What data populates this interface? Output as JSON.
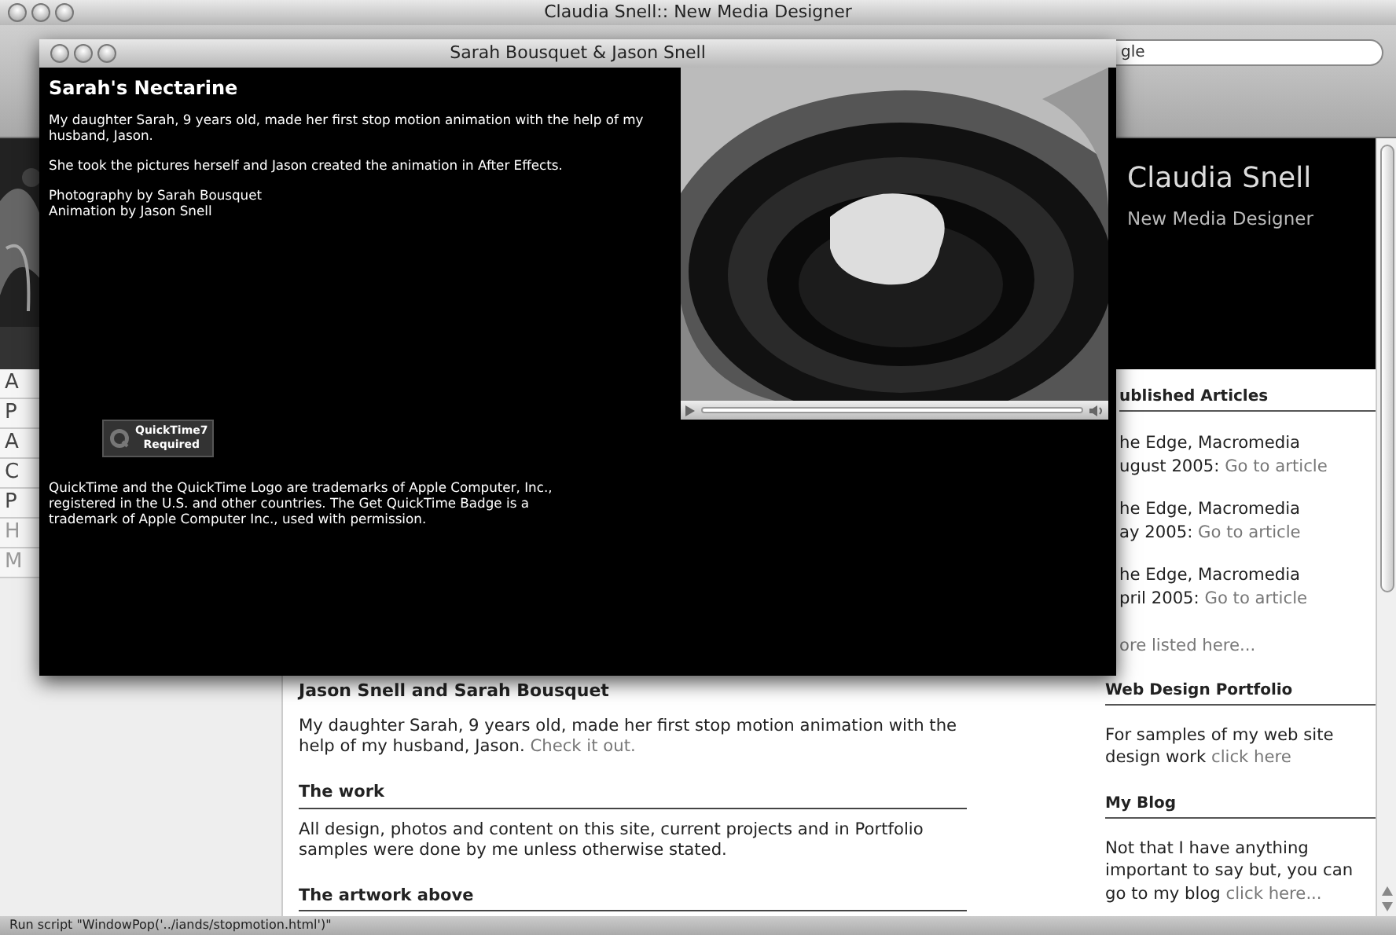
{
  "browser": {
    "title": "Claudia Snell:: New Media Designer",
    "search_value": "gle",
    "status_bar": "Run script \"WindowPop('../iands/stopmotion.html')\""
  },
  "site": {
    "logo_name": "Claudia Snell",
    "logo_tagline": "New Media Designer",
    "nav_items": [
      {
        "label": "A",
        "dimmed": false
      },
      {
        "label": "P",
        "dimmed": false
      },
      {
        "label": "A",
        "dimmed": false
      },
      {
        "label": "C",
        "dimmed": false
      },
      {
        "label": "P",
        "dimmed": false
      },
      {
        "label": "H",
        "dimmed": true
      },
      {
        "label": "M",
        "dimmed": true
      }
    ],
    "main": {
      "heading": "Jason Snell and Sarah Bousquet",
      "intro": "My daughter Sarah, 9 years old, made her first stop motion animation with the help of my husband, Jason.",
      "intro_link": "Check it out.",
      "sections": [
        {
          "heading": "The work",
          "text": "All design, photos and content on this site, current projects and in Portfolio samples were done by me unless otherwise stated."
        },
        {
          "heading": "The artwork above"
        }
      ]
    },
    "sidebar": {
      "articles_heading": "ublished Articles",
      "articles": [
        {
          "line1": "he Edge, Macromedia",
          "line2": "ugust 2005:",
          "link": "Go to article"
        },
        {
          "line1": "he Edge, Macromedia",
          "line2": "ay 2005:",
          "link": "Go to article"
        },
        {
          "line1": "he Edge, Macromedia",
          "line2": "pril 2005:",
          "link": "Go to article"
        }
      ],
      "more_link": "ore listed here...",
      "sections": [
        {
          "heading": "Web Design Portfolio",
          "text": "For samples of my web site design work",
          "link": "click here"
        },
        {
          "heading": "My Blog",
          "text": "Not that I have anything important to say but, you can go to my blog",
          "link": "click here..."
        }
      ]
    }
  },
  "popup": {
    "title": "Sarah Bousquet & Jason Snell",
    "heading": "Sarah's Nectarine",
    "paragraphs": [
      "My daughter Sarah, 9 years old, made her first stop motion animation with the help of my husband, Jason.",
      "She took the pictures herself and Jason created the animation in After Effects."
    ],
    "credits": [
      "Photography by Sarah Bousquet",
      "Animation by Jason Snell"
    ],
    "badge": [
      "QuickTime7",
      "Required"
    ],
    "notice": "QuickTime and the QuickTime Logo are trademarks of Apple Computer, Inc., registered in the U.S. and other countries. The Get QuickTime Badge is a trademark of Apple Computer Inc., used with permission."
  }
}
